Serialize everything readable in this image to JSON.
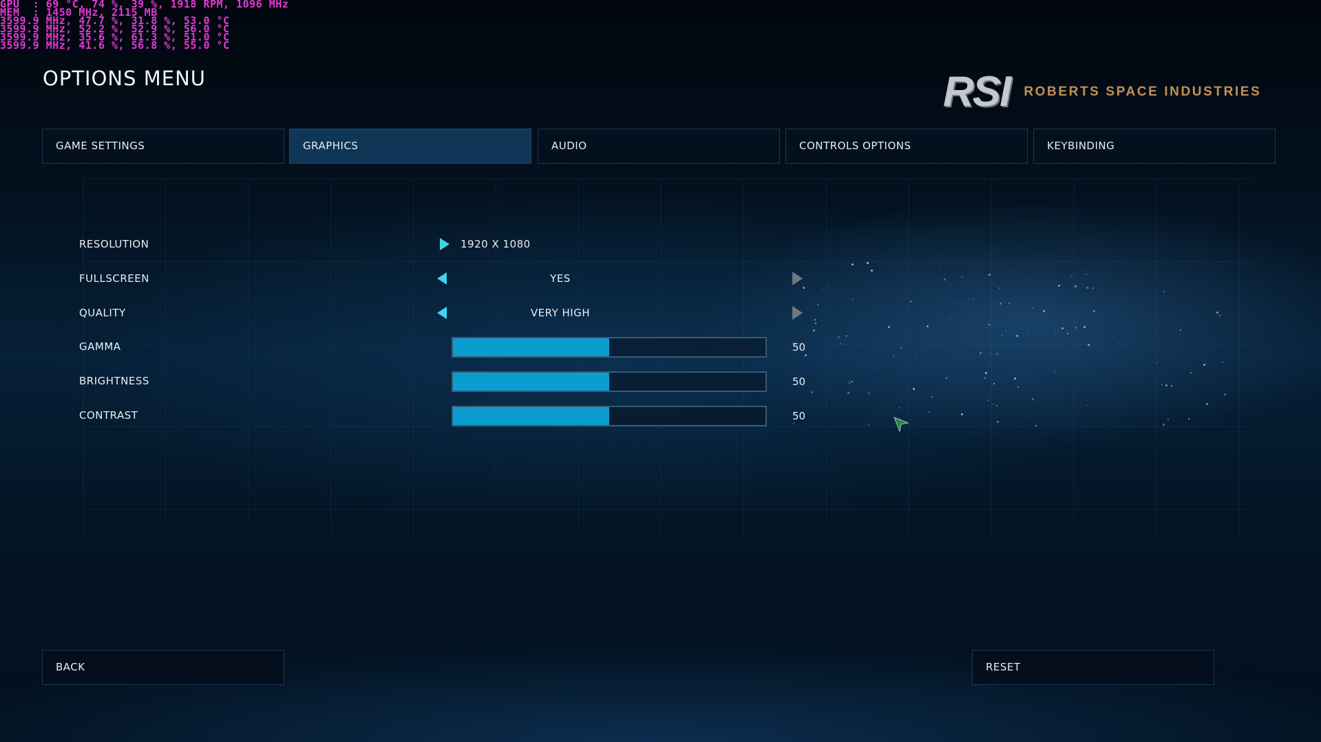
{
  "overlay": {
    "lines": [
      "GPU  : 69 °C, 74 %, 39 %, 1918 RPM, 1096 MHz",
      "MEM  : 1450 MHz, 2115 MB",
      "3599.9 MHz, 47.7 %, 31.8 %, 53.0 °C",
      "3599.9 MHz, 52.2 %, 52.9 %, 56.0 °C",
      "3599.9 MHz, 35.6 %, 61.3 %, 51.0 °C",
      "3599.9 MHz, 41.6 %, 56.8 %, 55.0 °C"
    ]
  },
  "header": {
    "title": "OPTIONS MENU",
    "logo_mark": "RSI",
    "logo_text": "ROBERTS SPACE INDUSTRIES"
  },
  "tabs": [
    {
      "label": "GAME SETTINGS",
      "active": false
    },
    {
      "label": "GRAPHICS",
      "active": true
    },
    {
      "label": "AUDIO",
      "active": false
    },
    {
      "label": "CONTROLS OPTIONS",
      "active": false
    },
    {
      "label": "KEYBINDING",
      "active": false
    }
  ],
  "settings": {
    "resolution": {
      "label": "RESOLUTION",
      "value": "1920 X 1080"
    },
    "fullscreen": {
      "label": "FULLSCREEN",
      "value": "YES"
    },
    "quality": {
      "label": "QUALITY",
      "value": "VERY HIGH"
    },
    "gamma": {
      "label": "GAMMA",
      "value": "50",
      "fraction": 0.5
    },
    "brightness": {
      "label": "BRIGHTNESS",
      "value": "50",
      "fraction": 0.5
    },
    "contrast": {
      "label": "CONTRAST",
      "value": "50",
      "fraction": 0.5
    }
  },
  "footer": {
    "back_label": "BACK",
    "reset_label": "RESET"
  },
  "icons": {
    "arrow_left": "chevron-left-icon",
    "arrow_right": "chevron-right-icon",
    "cursor": "mouse-cursor-icon"
  },
  "colors": {
    "accent": "#0a9ed0",
    "arrow_active": "#45d2ef",
    "arrow_inactive": "#6f7780",
    "logo_gold": "#c49156",
    "overlay_magenta": "#e23ad8"
  }
}
